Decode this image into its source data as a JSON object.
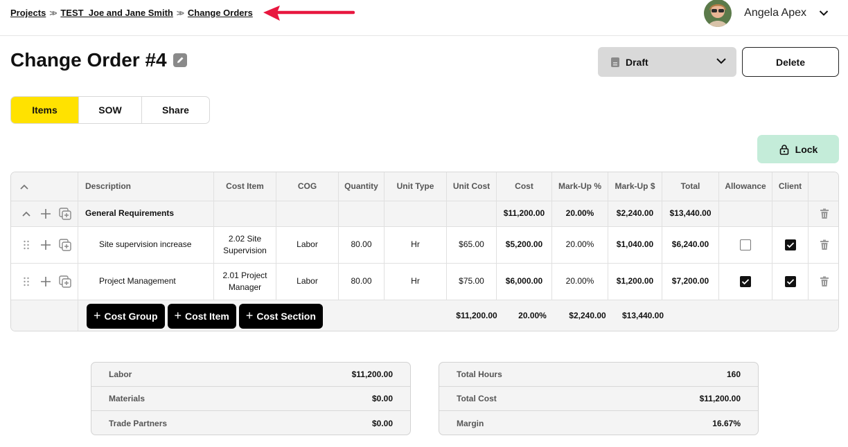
{
  "breadcrumb": [
    "Projects",
    "TEST_Joe and Jane Smith",
    "Change Orders"
  ],
  "user": {
    "name": "Angela Apex"
  },
  "title": "Change Order #4",
  "status": "Draft",
  "delete_label": "Delete",
  "tabs": [
    "Items",
    "SOW",
    "Share"
  ],
  "lock_label": "Lock",
  "table": {
    "headers": [
      "Description",
      "Cost Item",
      "COG",
      "Quantity",
      "Unit Type",
      "Unit Cost",
      "Cost",
      "Mark-Up %",
      "Mark-Up $",
      "Total",
      "Allowance",
      "Client"
    ],
    "group": {
      "description": "General Requirements",
      "cost": "$11,200.00",
      "markup_pct": "20.00%",
      "markup_amt": "$2,240.00",
      "total": "$13,440.00"
    },
    "items": [
      {
        "description": "Site supervision increase",
        "cost_item_1": "2.02 Site",
        "cost_item_2": "Supervision",
        "cog": "Labor",
        "quantity": "80.00",
        "unit_type": "Hr",
        "unit_cost": "$65.00",
        "cost": "$5,200.00",
        "markup_pct": "20.00%",
        "markup_amt": "$1,040.00",
        "total": "$6,240.00",
        "allowance": false,
        "client": true
      },
      {
        "description": "Project Management",
        "cost_item_1": "2.01 Project",
        "cost_item_2": "Manager",
        "cog": "Labor",
        "quantity": "80.00",
        "unit_type": "Hr",
        "unit_cost": "$75.00",
        "cost": "$6,000.00",
        "markup_pct": "20.00%",
        "markup_amt": "$1,200.00",
        "total": "$7,200.00",
        "allowance": true,
        "client": true
      }
    ],
    "footer": {
      "cost": "$11,200.00",
      "markup_pct": "20.00%",
      "markup_amt": "$2,240.00",
      "total": "$13,440.00"
    },
    "add_buttons": [
      "Cost Group",
      "Cost Item",
      "Cost Section"
    ]
  },
  "summary_left": [
    {
      "label": "Labor",
      "value": "$11,200.00"
    },
    {
      "label": "Materials",
      "value": "$0.00"
    },
    {
      "label": "Trade Partners",
      "value": "$0.00"
    }
  ],
  "summary_right": [
    {
      "label": "Total Hours",
      "value": "160"
    },
    {
      "label": "Total Cost",
      "value": "$11,200.00"
    },
    {
      "label": "Margin",
      "value": "16.67%"
    }
  ],
  "colors": {
    "accent_yellow": "#ffe200",
    "lock_green": "#c4ecd9",
    "arrow_red": "#e8173f"
  },
  "icons": [
    "edit-icon",
    "chevron-down-icon",
    "document-icon",
    "lock-icon",
    "drag-handle-icon",
    "plus-icon",
    "duplicate-icon",
    "trash-icon",
    "collapse-icon",
    "red-arrow-annotation"
  ]
}
